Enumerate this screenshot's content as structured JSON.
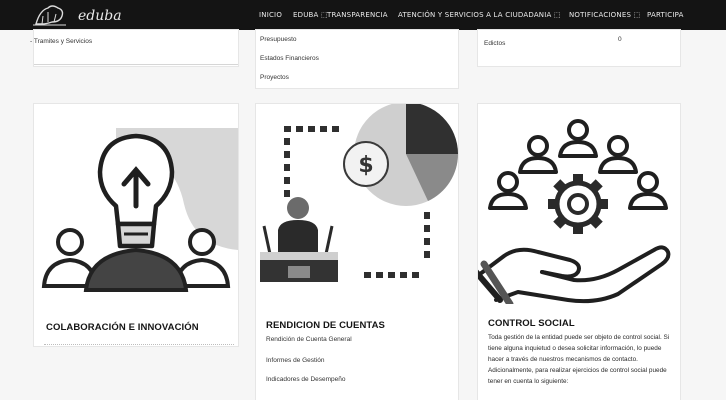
{
  "header": {
    "logo_text": "eduba",
    "nav": [
      "INICIO",
      "EDUBA ⬚",
      "TRANSPARENCIA",
      "ATENCIÓN Y SERVICIOS A LA CIUDADANIA ⬚",
      "NOTIFICACIONES ⬚",
      "PARTICIPA"
    ]
  },
  "top_cards": {
    "left": {
      "link": "- Tramites y Servicios"
    },
    "middle": {
      "links": [
        "Presupuesto",
        "Estados Financieros",
        "Proyectos"
      ]
    },
    "right": {
      "link": "Edictos",
      "value": "0"
    }
  },
  "cards": [
    {
      "title": "COLABORACIÓN E INNOVACIÓN",
      "icon": "lightbulb-team-icon"
    },
    {
      "title": "RENDICION DE CUENTAS",
      "icon": "presentation-pie-chart-icon",
      "links": [
        "Rendición de Cuenta General",
        "Informes de Gestión",
        "Indicadores de Desempeño"
      ]
    },
    {
      "title": "CONTROL SOCIAL",
      "icon": "hand-gear-people-icon",
      "body": "Toda gestión de la entidad puede ser objeto de control social. Si tiene alguna inquietud o desea solicitar información, lo puede hacer a través de nuestros mecanismos de contacto. Adicionalmente, para realizar ejercicios de control social puede tener en cuenta lo siguiente:"
    }
  ],
  "colors": {
    "topbar": "#141414",
    "page": "#f6f6f6",
    "card": "#ffffff"
  }
}
